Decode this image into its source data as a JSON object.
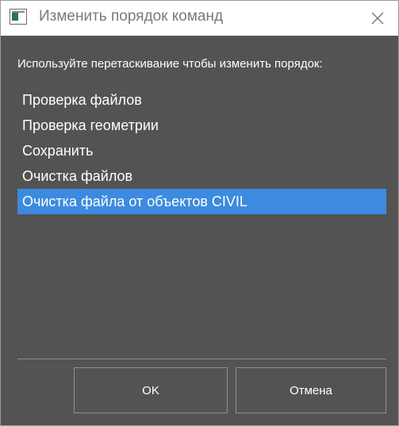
{
  "window": {
    "title": "Изменить порядок команд",
    "close_icon": "close-icon",
    "app_icon": "window-app-icon"
  },
  "dialog": {
    "instruction": "Используйте перетаскивание чтобы изменить порядок:",
    "items": [
      {
        "label": "Проверка файлов",
        "selected": false
      },
      {
        "label": "Проверка геометрии",
        "selected": false
      },
      {
        "label": "Сохранить",
        "selected": false
      },
      {
        "label": "Очистка файлов",
        "selected": false
      },
      {
        "label": "Очистка файла от объектов CIVIL",
        "selected": true
      }
    ],
    "ok_label": "OK",
    "cancel_label": "Отмена"
  },
  "colors": {
    "background": "#535353",
    "selection": "#3c8be0",
    "titlebar": "#ffffff"
  }
}
